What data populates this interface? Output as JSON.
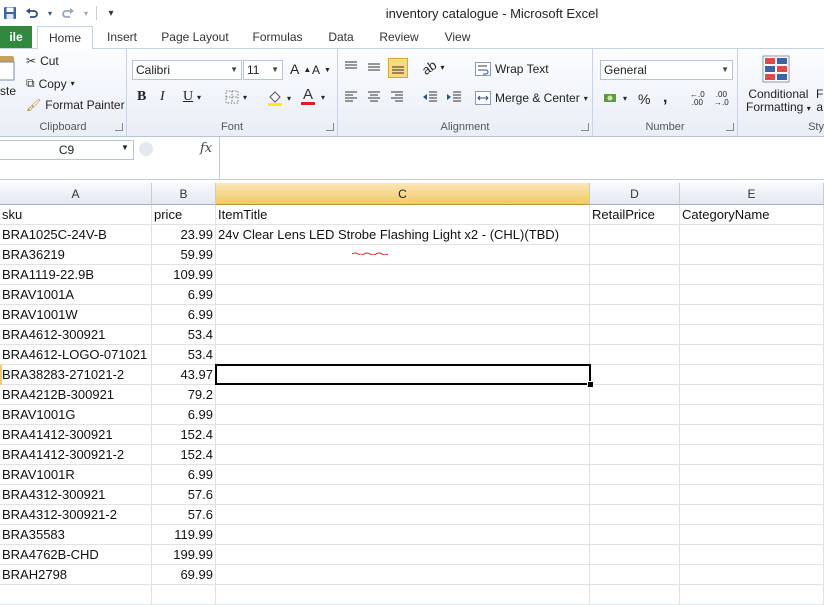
{
  "window": {
    "title": "inventory catalogue  -  Microsoft Excel"
  },
  "qat": {
    "save_icon": "save-icon",
    "undo_icon": "undo-icon",
    "redo_icon": "redo-icon",
    "customize": "▾"
  },
  "tabs": [
    {
      "label": "ile"
    },
    {
      "label": "Home"
    },
    {
      "label": "Insert"
    },
    {
      "label": "Page Layout"
    },
    {
      "label": "Formulas"
    },
    {
      "label": "Data"
    },
    {
      "label": "Review"
    },
    {
      "label": "View"
    }
  ],
  "ribbon": {
    "clipboard": {
      "label": "Clipboard",
      "paste": "ste",
      "cut": "Cut",
      "copy": "Copy",
      "format_painter": "Format Painter"
    },
    "font": {
      "label": "Font",
      "name": "Calibri",
      "size": "11",
      "bold": "B",
      "italic": "I",
      "underline": "U"
    },
    "alignment": {
      "label": "Alignment",
      "wrap_text": "Wrap Text",
      "merge_center": "Merge & Center"
    },
    "number": {
      "label": "Number",
      "format": "General",
      "percent": "%",
      "comma": ","
    },
    "styles": {
      "cond_line1": "Conditional",
      "cond_line2": "Formatting",
      "next1": "F",
      "next2": "a",
      "label": "Sty"
    }
  },
  "formula_bar": {
    "name_box": "C9",
    "fx": "fx",
    "content": ""
  },
  "columns": [
    {
      "label": "A"
    },
    {
      "label": "B"
    },
    {
      "label": "C"
    },
    {
      "label": "D"
    },
    {
      "label": "E"
    }
  ],
  "selected_cell": "C9",
  "rows": [
    [
      "sku",
      "price",
      "ItemTitle",
      "RetailPrice",
      "CategoryName"
    ],
    [
      "BRA1025C-24V-B",
      "23.99",
      "24v Clear Lens LED Strobe Flashing Light x2 - (CHL)(TBD)",
      "",
      ""
    ],
    [
      "BRA36219",
      "59.99",
      "",
      "",
      ""
    ],
    [
      "BRA1119-22.9B",
      "109.99",
      "",
      "",
      ""
    ],
    [
      "BRAV1001A",
      "6.99",
      "",
      "",
      ""
    ],
    [
      "BRAV1001W",
      "6.99",
      "",
      "",
      ""
    ],
    [
      "BRA4612-300921",
      "53.4",
      "",
      "",
      ""
    ],
    [
      "BRA4612-LOGO-071021",
      "53.4",
      "",
      "",
      ""
    ],
    [
      "BRA38283-271021-2",
      "43.97",
      "",
      "",
      ""
    ],
    [
      "BRA4212B-300921",
      "79.2",
      "",
      "",
      ""
    ],
    [
      "BRAV1001G",
      "6.99",
      "",
      "",
      ""
    ],
    [
      "BRA41412-300921",
      "152.4",
      "",
      "",
      ""
    ],
    [
      "BRA41412-300921-2",
      "152.4",
      "",
      "",
      ""
    ],
    [
      "BRAV1001R",
      "6.99",
      "",
      "",
      ""
    ],
    [
      "BRA4312-300921",
      "57.6",
      "",
      "",
      ""
    ],
    [
      "BRA4312-300921-2",
      "57.6",
      "",
      "",
      ""
    ],
    [
      "BRA35583",
      "119.99",
      "",
      "",
      ""
    ],
    [
      "BRA4762B-CHD",
      "199.99",
      "",
      "",
      ""
    ],
    [
      "BRAH2798",
      "69.99",
      "",
      "",
      ""
    ],
    [
      "",
      "",
      "",
      "",
      ""
    ]
  ],
  "colors": {
    "file_tab": "#2f8a3e",
    "selected_header": "#f2c86b",
    "spell_underline": "#e02020"
  }
}
